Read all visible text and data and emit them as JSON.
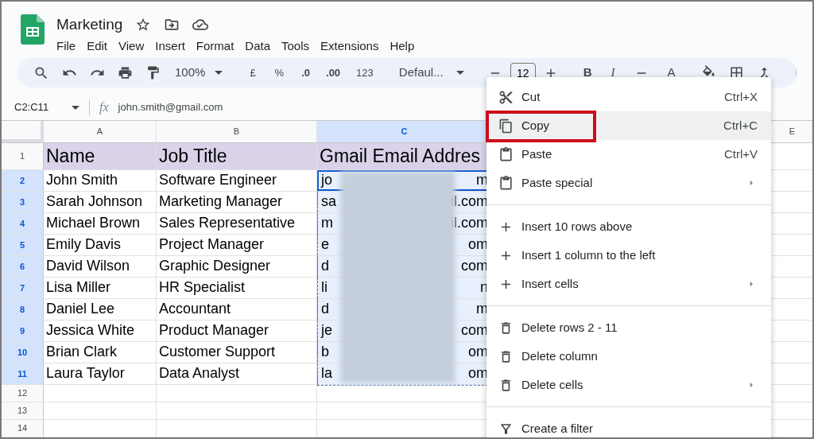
{
  "document": {
    "title": "Marketing"
  },
  "menu_bar": [
    "File",
    "Edit",
    "View",
    "Insert",
    "Format",
    "Data",
    "Tools",
    "Extensions",
    "Help"
  ],
  "toolbar": {
    "zoom": "100%",
    "currency": "£",
    "percent": "%",
    "decrease_decimal": ".0",
    "increase_decimal": ".00",
    "number_format": "123",
    "font": "Defaul...",
    "font_size": "12",
    "bold": "B",
    "italic": "I",
    "text_color": "A"
  },
  "name_box": "C2:C11",
  "function_label": "fx",
  "formula": "john.smith@gmail.com",
  "sheet": {
    "columns": [
      {
        "label": "A",
        "selected": false
      },
      {
        "label": "B",
        "selected": false
      },
      {
        "label": "C",
        "selected": true
      },
      {
        "label": "E",
        "selected": false
      }
    ],
    "rows": [
      {
        "number": "1",
        "selected": false,
        "kind": "header",
        "cells": [
          "Name",
          "Job Title",
          "Gmail Email Addres"
        ]
      },
      {
        "number": "2",
        "selected": true,
        "kind": "data",
        "cells": [
          "John Smith",
          "Software Engineer"
        ],
        "email": {
          "start": "jo",
          "end": "m"
        }
      },
      {
        "number": "3",
        "selected": true,
        "kind": "data",
        "cells": [
          "Sarah Johnson",
          "Marketing Manager"
        ],
        "email": {
          "start": "sa",
          "end": "il.com"
        }
      },
      {
        "number": "4",
        "selected": true,
        "kind": "data",
        "cells": [
          "Michael Brown",
          "Sales Representative"
        ],
        "email": {
          "start": "m",
          "end": "il.com"
        }
      },
      {
        "number": "5",
        "selected": true,
        "kind": "data",
        "cells": [
          "Emily Davis",
          "Project Manager"
        ],
        "email": {
          "start": "e",
          "end": "om"
        }
      },
      {
        "number": "6",
        "selected": true,
        "kind": "data",
        "cells": [
          "David Wilson",
          "Graphic Designer"
        ],
        "email": {
          "start": "d",
          "end": "com"
        }
      },
      {
        "number": "7",
        "selected": true,
        "kind": "data",
        "cells": [
          "Lisa Miller",
          "HR Specialist"
        ],
        "email": {
          "start": "li",
          "end": "n"
        }
      },
      {
        "number": "8",
        "selected": true,
        "kind": "data",
        "cells": [
          "Daniel Lee",
          "Accountant"
        ],
        "email": {
          "start": "d",
          "end": "m"
        }
      },
      {
        "number": "9",
        "selected": true,
        "kind": "data",
        "cells": [
          "Jessica White",
          "Product Manager"
        ],
        "email": {
          "start": "je",
          "end": "com"
        }
      },
      {
        "number": "10",
        "selected": true,
        "kind": "data",
        "cells": [
          "Brian Clark",
          "Customer Support"
        ],
        "email": {
          "start": "b",
          "end": "om"
        }
      },
      {
        "number": "11",
        "selected": true,
        "kind": "data",
        "cells": [
          "Laura Taylor",
          "Data Analyst"
        ],
        "email": {
          "start": "la",
          "end": "om"
        }
      },
      {
        "number": "12",
        "selected": false,
        "kind": "empty"
      },
      {
        "number": "13",
        "selected": false,
        "kind": "empty"
      },
      {
        "number": "14",
        "selected": false,
        "kind": "empty"
      }
    ]
  },
  "context_menu": {
    "groups": [
      [
        {
          "kind": "cut",
          "label": "Cut",
          "shortcut": "Ctrl+X",
          "highlighted": false,
          "outlined": false,
          "submenu": false
        },
        {
          "kind": "copy",
          "label": "Copy",
          "shortcut": "Ctrl+C",
          "highlighted": true,
          "outlined": true,
          "submenu": false
        },
        {
          "kind": "paste",
          "label": "Paste",
          "shortcut": "Ctrl+V",
          "highlighted": false,
          "outlined": false,
          "submenu": false
        },
        {
          "kind": "paste",
          "label": "Paste special",
          "highlighted": false,
          "outlined": false,
          "submenu": true
        }
      ],
      [
        {
          "kind": "insert",
          "label": "Insert 10 rows above",
          "highlighted": false,
          "outlined": false,
          "submenu": false
        },
        {
          "kind": "insert",
          "label": "Insert 1 column to the left",
          "highlighted": false,
          "outlined": false,
          "submenu": false
        },
        {
          "kind": "insert",
          "label": "Insert cells",
          "highlighted": false,
          "outlined": false,
          "submenu": true
        }
      ],
      [
        {
          "kind": "delete",
          "label": "Delete rows 2 - 11",
          "highlighted": false,
          "outlined": false,
          "submenu": false
        },
        {
          "kind": "delete",
          "label": "Delete column",
          "highlighted": false,
          "outlined": false,
          "submenu": false
        },
        {
          "kind": "delete",
          "label": "Delete cells",
          "highlighted": false,
          "outlined": false,
          "submenu": true
        }
      ],
      [
        {
          "kind": "filter",
          "label": "Create a filter",
          "highlighted": false,
          "outlined": false,
          "submenu": false
        }
      ]
    ]
  }
}
